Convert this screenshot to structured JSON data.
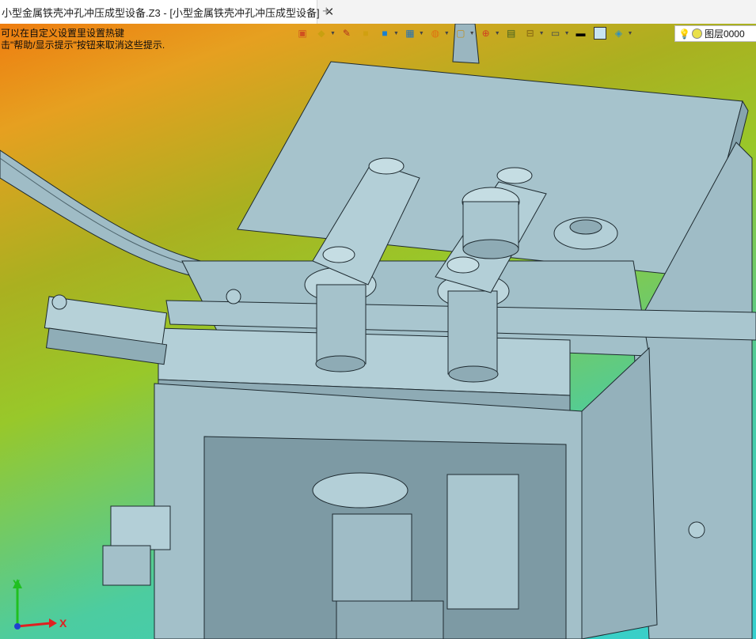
{
  "window": {
    "tab_title": "小型金属铁壳冲孔冲压成型设备.Z3 - [小型金属铁壳冲孔冲压成型设备]",
    "tab_close": "✕",
    "new_tab": "+"
  },
  "hints": {
    "line1": "可以在自定义设置里设置热键",
    "line2": "击\"帮助/显示提示\"按钮来取消这些提示."
  },
  "toolbar": {
    "icons": [
      "view-icon",
      "paint-bucket-icon",
      "pen-icon",
      "shaded-cube-icon",
      "blue-cube-icon",
      "cube-display-icon",
      "sphere-icon",
      "frame-icon",
      "crosshair-icon",
      "viewport-icon",
      "split-icon",
      "monitor-icon",
      "line-style-icon",
      "color-square-icon",
      "layers-icon"
    ],
    "layer_label": "图层0000"
  },
  "axes": {
    "y": "Y",
    "x": "X"
  },
  "colors": {
    "metal": "#a9c6cf",
    "metal_dark": "#7f9ea8",
    "axis_y": "#20c020",
    "axis_x": "#e02020"
  }
}
